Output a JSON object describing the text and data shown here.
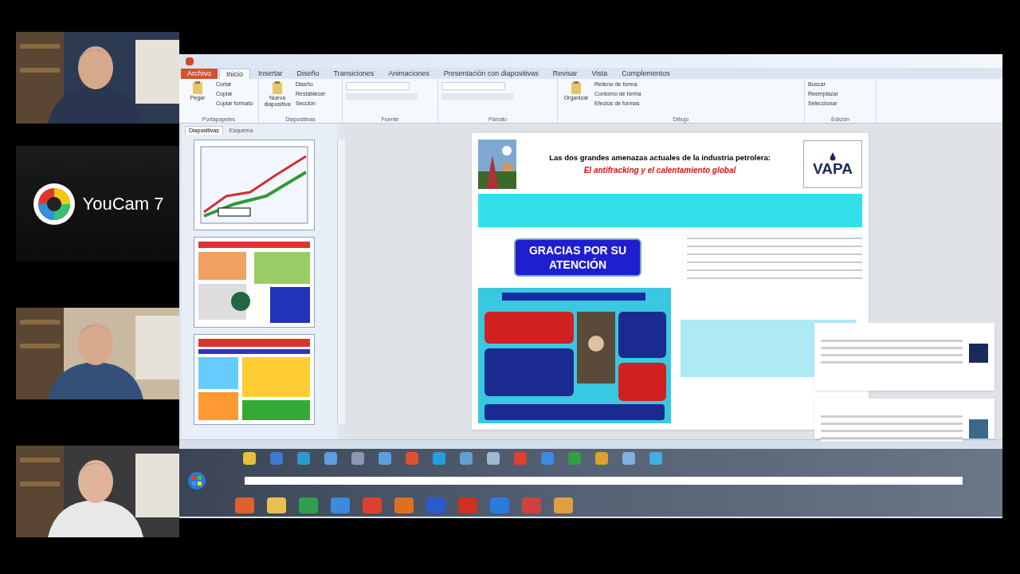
{
  "participants": [
    {
      "kind": "camera"
    },
    {
      "kind": "app_logo",
      "title": "YouCam 7"
    },
    {
      "kind": "camera"
    },
    {
      "kind": "camera"
    }
  ],
  "ribbon": {
    "tabs": [
      {
        "label": "Archivo",
        "kind": "file",
        "selected": false
      },
      {
        "label": "Inicio",
        "kind": "tab",
        "selected": true
      },
      {
        "label": "Insertar",
        "kind": "tab",
        "selected": false
      },
      {
        "label": "Diseño",
        "kind": "tab",
        "selected": false
      },
      {
        "label": "Transiciones",
        "kind": "tab",
        "selected": false
      },
      {
        "label": "Animaciones",
        "kind": "tab",
        "selected": false
      },
      {
        "label": "Presentación con diapositivas",
        "kind": "tab",
        "selected": false
      },
      {
        "label": "Revisar",
        "kind": "tab",
        "selected": false
      },
      {
        "label": "Vista",
        "kind": "tab",
        "selected": false
      },
      {
        "label": "Complementos",
        "kind": "tab",
        "selected": false
      }
    ],
    "groups": [
      {
        "label": "Portapapeles",
        "buttons": [
          "Cortar",
          "Copiar",
          "Copiar formato"
        ],
        "big": "Pegar"
      },
      {
        "label": "Diapositivas",
        "buttons": [
          "Diseño",
          "Restablecer",
          "Sección"
        ],
        "big": "Nueva diapositiva"
      },
      {
        "label": "Fuente"
      },
      {
        "label": "Párrafo"
      },
      {
        "label": "Dibujo",
        "buttons": [
          "Relleno de forma",
          "Contorno de forma",
          "Efectos de formas"
        ],
        "big": "Organizar"
      },
      {
        "label": "Edición",
        "buttons": [
          "Buscar",
          "Reemplazar",
          "Seleccionar"
        ]
      }
    ]
  },
  "slide_panel": {
    "tabs": [
      {
        "label": "Diapositivas",
        "selected": true
      },
      {
        "label": "Esquema",
        "selected": false
      }
    ],
    "thumbnails": [
      {
        "kind": "chart"
      },
      {
        "kind": "tables"
      },
      {
        "kind": "poster"
      }
    ]
  },
  "slide": {
    "title": "Las dos grandes amenazas actuales de la industria petrolera:",
    "subtitle": "El antifracking y el calentamiento global",
    "logo": "VAPA",
    "thanks": "GRACIAS POR SU ATENCIÓN"
  },
  "notifications": [
    {
      "kind": "news"
    },
    {
      "kind": "news"
    }
  ]
}
